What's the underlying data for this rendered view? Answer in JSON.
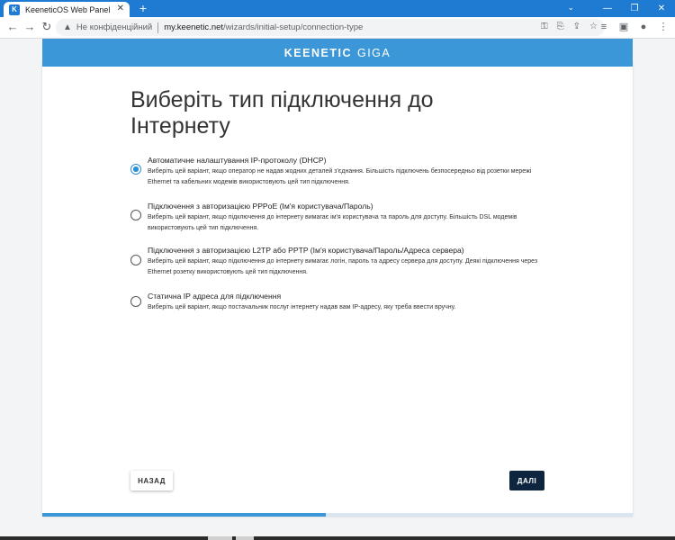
{
  "browser": {
    "tab_title": "KeeneticOS Web Panel",
    "tab_favicon": "K",
    "new_tab": "+",
    "not_secure": "Не конфіденційний",
    "url_host": "my.keenetic.net",
    "url_path": "/wizards/initial-setup/connection-type"
  },
  "brand": {
    "name": "KEENETIC",
    "model": "GIGA"
  },
  "page": {
    "heading": "Виберіть тип підключення до Інтернету"
  },
  "options": [
    {
      "title": "Автоматичне налаштування IP-протоколу (DHCP)",
      "description": "Виберіть цей варіант, якщо оператор не надав жодних деталей з'єднання. Більшість підключень безпосередньо від розетки мережі Ethernet та кабельних модемів використовують цей тип підключення.",
      "selected": true
    },
    {
      "title": "Підключення з авторизацією PPPoE (Ім'я користувача/Пароль)",
      "description": "Виберіть цей варіант, якщо підключення до інтернету вимагає ім'я користувача та пароль для доступу. Більшість DSL модемів використовують цей тип підключення.",
      "selected": false
    },
    {
      "title": "Підключення з авторизацією L2TP або PPTP (Ім'я користувача/Пароль/Адреса сервера)",
      "description": "Виберіть цей варіант, якщо підключення до інтернету вимагає логін, пароль та адресу сервера для доступу. Деякі підключення через Ethernet розетку використовують цей тип підключення.",
      "selected": false
    },
    {
      "title": "Статична IP адреса для підключення",
      "description": "Виберіть цей варіант, якщо постачальник послуг інтернету надав вам IP-адресу, яку треба ввести вручну.",
      "selected": false
    }
  ],
  "buttons": {
    "back": "НАЗАД",
    "next": "ДАЛІ"
  },
  "progress": {
    "fraction": 0.48
  },
  "colors": {
    "accent": "#3c97d8",
    "radio_selected": "#2d8fd6",
    "next_button": "#0e2540",
    "browser_frame": "#1f7ad2"
  }
}
